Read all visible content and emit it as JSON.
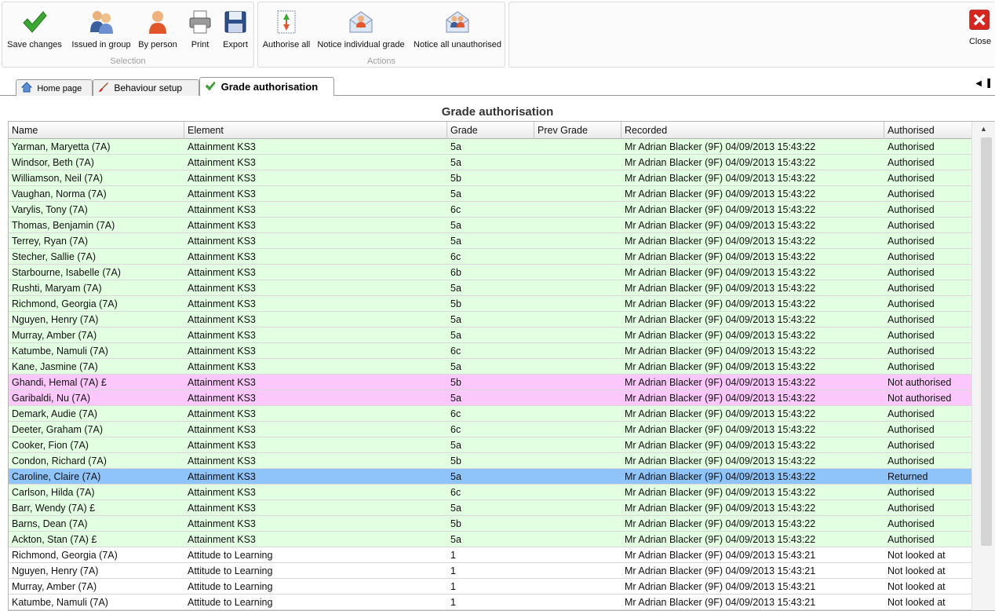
{
  "toolbar": {
    "selection_label": "Selection",
    "actions_label": "Actions",
    "save_changes": "Save changes",
    "issued_in_group": "Issued in group",
    "by_person": "By person",
    "print": "Print",
    "export": "Export",
    "authorise_all": "Authorise all",
    "notice_individual_grade": "Notice individual grade",
    "notice_all_unauthorised": "Notice all unauthorised",
    "close": "Close"
  },
  "tabs": [
    {
      "label": "Home page",
      "icon": "home-icon"
    },
    {
      "label": "Behaviour setup",
      "icon": "brush-icon"
    },
    {
      "label": "Grade authorisation",
      "icon": "check-icon"
    }
  ],
  "grid": {
    "title": "Grade authorisation",
    "columns": [
      "Name",
      "Element",
      "Grade",
      "Prev Grade",
      "Recorded",
      "Authorised"
    ],
    "rows": [
      {
        "name": "Yarman, Maryetta (7A)",
        "element": "Attainment KS3",
        "grade": "5a",
        "prev": "",
        "recorded": "Mr Adrian Blacker (9F) 04/09/2013 15:43:22",
        "status": "Authorised"
      },
      {
        "name": "Windsor, Beth (7A)",
        "element": "Attainment KS3",
        "grade": "5a",
        "prev": "",
        "recorded": "Mr Adrian Blacker (9F) 04/09/2013 15:43:22",
        "status": "Authorised"
      },
      {
        "name": "Williamson, Neil (7A)",
        "element": "Attainment KS3",
        "grade": "5b",
        "prev": "",
        "recorded": "Mr Adrian Blacker (9F) 04/09/2013 15:43:22",
        "status": "Authorised"
      },
      {
        "name": "Vaughan, Norma (7A)",
        "element": "Attainment KS3",
        "grade": "5a",
        "prev": "",
        "recorded": "Mr Adrian Blacker (9F) 04/09/2013 15:43:22",
        "status": "Authorised"
      },
      {
        "name": "Varylis, Tony (7A)",
        "element": "Attainment KS3",
        "grade": "6c",
        "prev": "",
        "recorded": "Mr Adrian Blacker (9F) 04/09/2013 15:43:22",
        "status": "Authorised"
      },
      {
        "name": "Thomas, Benjamin (7A)",
        "element": "Attainment KS3",
        "grade": "5a",
        "prev": "",
        "recorded": "Mr Adrian Blacker (9F) 04/09/2013 15:43:22",
        "status": "Authorised"
      },
      {
        "name": "Terrey, Ryan (7A)",
        "element": "Attainment KS3",
        "grade": "5a",
        "prev": "",
        "recorded": "Mr Adrian Blacker (9F) 04/09/2013 15:43:22",
        "status": "Authorised"
      },
      {
        "name": "Stecher, Sallie (7A)",
        "element": "Attainment KS3",
        "grade": "6c",
        "prev": "",
        "recorded": "Mr Adrian Blacker (9F) 04/09/2013 15:43:22",
        "status": "Authorised"
      },
      {
        "name": "Starbourne, Isabelle (7A)",
        "element": "Attainment KS3",
        "grade": "6b",
        "prev": "",
        "recorded": "Mr Adrian Blacker (9F) 04/09/2013 15:43:22",
        "status": "Authorised"
      },
      {
        "name": "Rushti, Maryam (7A)",
        "element": "Attainment KS3",
        "grade": "5a",
        "prev": "",
        "recorded": "Mr Adrian Blacker (9F) 04/09/2013 15:43:22",
        "status": "Authorised"
      },
      {
        "name": "Richmond, Georgia (7A)",
        "element": "Attainment KS3",
        "grade": "5b",
        "prev": "",
        "recorded": "Mr Adrian Blacker (9F) 04/09/2013 15:43:22",
        "status": "Authorised"
      },
      {
        "name": "Nguyen, Henry (7A)",
        "element": "Attainment KS3",
        "grade": "5a",
        "prev": "",
        "recorded": "Mr Adrian Blacker (9F) 04/09/2013 15:43:22",
        "status": "Authorised"
      },
      {
        "name": "Murray, Amber (7A)",
        "element": "Attainment KS3",
        "grade": "5a",
        "prev": "",
        "recorded": "Mr Adrian Blacker (9F) 04/09/2013 15:43:22",
        "status": "Authorised"
      },
      {
        "name": "Katumbe, Namuli (7A)",
        "element": "Attainment KS3",
        "grade": "6c",
        "prev": "",
        "recorded": "Mr Adrian Blacker (9F) 04/09/2013 15:43:22",
        "status": "Authorised"
      },
      {
        "name": "Kane, Jasmine (7A)",
        "element": "Attainment KS3",
        "grade": "5a",
        "prev": "",
        "recorded": "Mr Adrian Blacker (9F) 04/09/2013 15:43:22",
        "status": "Authorised"
      },
      {
        "name": "Ghandi, Hemal (7A)   £",
        "element": "Attainment KS3",
        "grade": "5b",
        "prev": "",
        "recorded": "Mr Adrian Blacker (9F) 04/09/2013 15:43:22",
        "status": "Not authorised"
      },
      {
        "name": "Garibaldi, Nu (7A)",
        "element": "Attainment KS3",
        "grade": "5a",
        "prev": "",
        "recorded": "Mr Adrian Blacker (9F) 04/09/2013 15:43:22",
        "status": "Not authorised"
      },
      {
        "name": "Demark, Audie (7A)",
        "element": "Attainment KS3",
        "grade": "6c",
        "prev": "",
        "recorded": "Mr Adrian Blacker (9F) 04/09/2013 15:43:22",
        "status": "Authorised"
      },
      {
        "name": "Deeter, Graham (7A)",
        "element": "Attainment KS3",
        "grade": "6c",
        "prev": "",
        "recorded": "Mr Adrian Blacker (9F) 04/09/2013 15:43:22",
        "status": "Authorised"
      },
      {
        "name": "Cooker, Fion (7A)",
        "element": "Attainment KS3",
        "grade": "5a",
        "prev": "",
        "recorded": "Mr Adrian Blacker (9F) 04/09/2013 15:43:22",
        "status": "Authorised"
      },
      {
        "name": "Condon, Richard (7A)",
        "element": "Attainment KS3",
        "grade": "5b",
        "prev": "",
        "recorded": "Mr Adrian Blacker (9F) 04/09/2013 15:43:22",
        "status": "Authorised"
      },
      {
        "name": "Caroline, Claire (7A)",
        "element": "Attainment KS3",
        "grade": "5a",
        "prev": "",
        "recorded": "Mr Adrian Blacker (9F) 04/09/2013 15:43:22",
        "status": "Returned"
      },
      {
        "name": "Carlson, Hilda (7A)",
        "element": "Attainment KS3",
        "grade": "6c",
        "prev": "",
        "recorded": "Mr Adrian Blacker (9F) 04/09/2013 15:43:22",
        "status": "Authorised"
      },
      {
        "name": "Barr, Wendy (7A)   £",
        "element": "Attainment KS3",
        "grade": "5a",
        "prev": "",
        "recorded": "Mr Adrian Blacker (9F) 04/09/2013 15:43:22",
        "status": "Authorised"
      },
      {
        "name": "Barns, Dean (7A)",
        "element": "Attainment KS3",
        "grade": "5b",
        "prev": "",
        "recorded": "Mr Adrian Blacker (9F) 04/09/2013 15:43:22",
        "status": "Authorised"
      },
      {
        "name": "Ackton, Stan (7A)   £",
        "element": "Attainment KS3",
        "grade": "5a",
        "prev": "",
        "recorded": "Mr Adrian Blacker (9F) 04/09/2013 15:43:22",
        "status": "Authorised"
      },
      {
        "name": "Richmond, Georgia (7A)",
        "element": "Attitude to Learning",
        "grade": "1",
        "prev": "",
        "recorded": "Mr Adrian Blacker (9F) 04/09/2013 15:43:21",
        "status": "Not looked at"
      },
      {
        "name": "Nguyen, Henry (7A)",
        "element": "Attitude to Learning",
        "grade": "1",
        "prev": "",
        "recorded": "Mr Adrian Blacker (9F) 04/09/2013 15:43:21",
        "status": "Not looked at"
      },
      {
        "name": "Murray, Amber (7A)",
        "element": "Attitude to Learning",
        "grade": "1",
        "prev": "",
        "recorded": "Mr Adrian Blacker (9F) 04/09/2013 15:43:21",
        "status": "Not looked at"
      },
      {
        "name": "Katumbe, Namuli (7A)",
        "element": "Attitude to Learning",
        "grade": "1",
        "prev": "",
        "recorded": "Mr Adrian Blacker (9F) 04/09/2013 15:43:21",
        "status": "Not looked at"
      }
    ]
  },
  "colors": {
    "authorised_row": "#e2ffe2",
    "not_authorised_row": "#fcc8fc",
    "selected_row": "#8ec4fa",
    "close_red": "#d8261e"
  }
}
